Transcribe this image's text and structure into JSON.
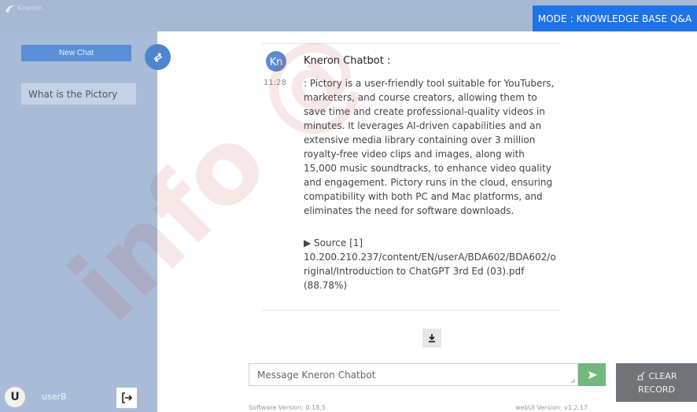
{
  "header": {
    "logo_text": "Kneron",
    "mode_label": "MODE : KNOWLEDGE BASE Q&A"
  },
  "sidebar": {
    "new_chat_label": "New Chat",
    "history": [
      {
        "label": "What is the Pictory"
      }
    ],
    "user": {
      "initial": "U",
      "name": "userB"
    }
  },
  "chat": {
    "bot_avatar_text": "Kn",
    "bot_name": "Kneron Chatbot :",
    "time": "11:28",
    "message": ": Pictory is a user-friendly tool suitable for YouTubers, marketers, and course creators, allowing them to save time and create professional-quality videos in minutes. It leverages AI-driven capabilities and an extensive media library containing over 3 million royalty-free video clips and images, along with 15,000 music soundtracks, to enhance video quality and engagement. Pictory runs in the cloud, ensuring compatibility with both PC and Mac platforms, and eliminates the need for software downloads.",
    "source_label": "▶ Source [1]",
    "source_path": "10.200.210.237/content/EN/userA/BDA602/BDA602/original/Introduction to ChatGPT 3rd Ed (03).pdf",
    "source_score": "(88.78%)"
  },
  "composer": {
    "placeholder": "Message Kneron Chatbot",
    "value": "",
    "clear_line1": "CLEAR",
    "clear_line2": "RECORD"
  },
  "footer": {
    "software_version": "Software Version: 0.18.5",
    "webui_version": "webUI Version: v1.2.17"
  },
  "watermark": {
    "text": "info @"
  },
  "colors": {
    "topbar": "#a6b8d2",
    "sidebar": "#a8bcd8",
    "accent": "#1f73e8",
    "send": "#72b77e",
    "clear": "#707377"
  },
  "icons": {
    "toggle": "swap-arrows-icon",
    "logout": "logout-icon",
    "download": "download-icon",
    "send": "send-icon",
    "clear": "broom-icon"
  }
}
